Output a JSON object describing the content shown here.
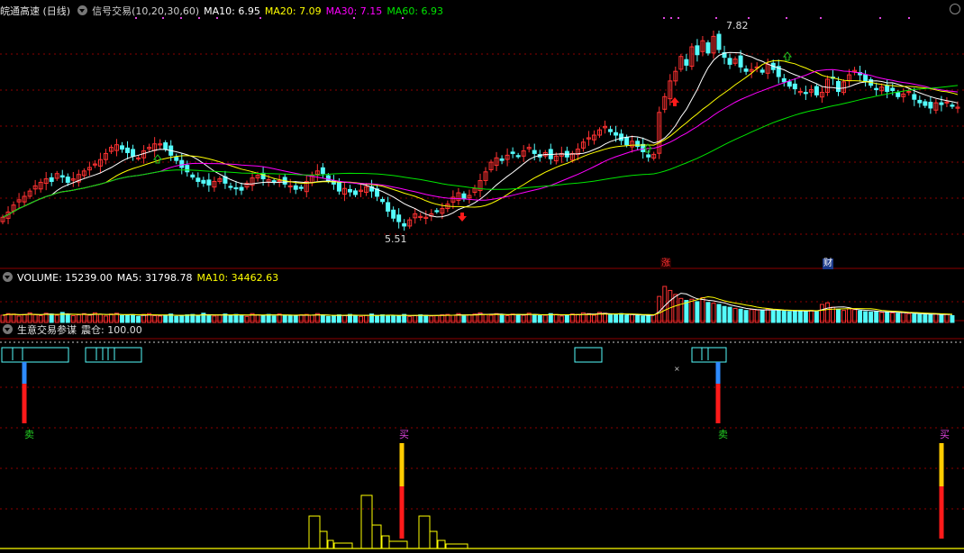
{
  "header1": {
    "title": "皖通高速 (日线)",
    "indicator": "信号交易(10,20,30,60)",
    "ma10": "MA10: 6.95",
    "ma20": "MA20: 7.09",
    "ma30": "MA30: 7.15",
    "ma60": "MA60: 6.93"
  },
  "header2": {
    "volume": "VOLUME: 15239.00",
    "ma5": "MA5: 31798.78",
    "ma10": "MA10: 34462.63"
  },
  "header3": {
    "title": "生意交易参谋",
    "position": "震仓: 100.00"
  },
  "annotations": {
    "high_label": "7.82",
    "low_label": "5.51",
    "zhang_tag": "涨",
    "cai_tag": "财",
    "sell1": "卖",
    "buy1": "买",
    "sell2": "卖",
    "buy2": "买"
  },
  "colors": {
    "up": "#ff3232",
    "down": "#54fcfc",
    "ma10": "#ffffff",
    "ma20": "#ffff00",
    "ma30": "#ff00ff",
    "ma60": "#00e600",
    "grid": "#8b0000",
    "sell": "#22cc22",
    "buy": "#dd44dd"
  },
  "chart_data": {
    "type": "candlestick",
    "price_range": [
      5.3,
      8.0
    ],
    "volume_range": [
      0,
      90000
    ],
    "high": 7.82,
    "low": 5.51,
    "series": [
      {
        "name": "MA10",
        "value": 6.95
      },
      {
        "name": "MA20",
        "value": 7.09
      },
      {
        "name": "MA30",
        "value": 7.15
      },
      {
        "name": "MA60",
        "value": 6.93
      }
    ],
    "close": [
      5.72,
      5.78,
      5.86,
      5.92,
      5.96,
      6.02,
      6.08,
      6.12,
      6.16,
      6.13,
      6.22,
      6.18,
      6.12,
      6.16,
      6.21,
      6.25,
      6.29,
      6.33,
      6.38,
      6.45,
      6.52,
      6.55,
      6.5,
      6.46,
      6.42,
      6.4,
      6.48,
      6.52,
      6.56,
      6.56,
      6.5,
      6.43,
      6.37,
      6.29,
      6.24,
      6.18,
      6.13,
      6.11,
      6.09,
      6.13,
      6.16,
      6.11,
      6.07,
      6.05,
      6.03,
      6.11,
      6.17,
      6.2,
      6.16,
      6.15,
      6.12,
      6.14,
      6.1,
      6.08,
      6.04,
      6.05,
      6.13,
      6.2,
      6.25,
      6.22,
      6.14,
      6.1,
      6.02,
      6.05,
      6.01,
      5.98,
      6.03,
      6.07,
      6.02,
      5.96,
      5.9,
      5.79,
      5.71,
      5.67,
      5.62,
      5.69,
      5.76,
      5.73,
      5.72,
      5.76,
      5.79,
      5.82,
      5.87,
      5.95,
      6.0,
      5.93,
      5.97,
      6.05,
      6.14,
      6.24,
      6.35,
      6.4,
      6.37,
      6.43,
      6.45,
      6.42,
      6.48,
      6.52,
      6.45,
      6.41,
      6.46,
      6.39,
      6.42,
      6.45,
      6.41,
      6.45,
      6.5,
      6.58,
      6.63,
      6.66,
      6.72,
      6.76,
      6.7,
      6.66,
      6.6,
      6.55,
      6.59,
      6.53,
      6.47,
      6.41,
      6.44,
      6.92,
      7.1,
      7.28,
      7.39,
      7.56,
      7.46,
      7.67,
      7.58,
      7.74,
      7.6,
      7.79,
      7.64,
      7.55,
      7.47,
      7.53,
      7.44,
      7.39,
      7.41,
      7.44,
      7.38,
      7.47,
      7.41,
      7.33,
      7.27,
      7.22,
      7.19,
      7.16,
      7.14,
      7.18,
      7.12,
      7.15,
      7.3,
      7.31,
      7.16,
      7.27,
      7.35,
      7.4,
      7.35,
      7.27,
      7.23,
      7.18,
      7.21,
      7.16,
      7.17,
      7.1,
      7.13,
      7.16,
      7.07,
      7.03,
      7.0,
      6.97,
      7.03,
      7.01,
      7.04,
      6.99,
      6.98
    ],
    "volume": [
      18000,
      22000,
      21000,
      16000,
      20000,
      24000,
      19000,
      17000,
      23000,
      21000,
      18000,
      25000,
      20000,
      17000,
      19000,
      22000,
      18000,
      24000,
      20000,
      16000,
      21000,
      23000,
      17000,
      19000,
      18000,
      15000,
      20000,
      22000,
      17000,
      16000,
      18000,
      21000,
      15000,
      17000,
      19000,
      20000,
      18000,
      23000,
      17000,
      16000,
      19000,
      21000,
      18000,
      20000,
      17000,
      15000,
      22000,
      19000,
      18000,
      20000,
      16000,
      21000,
      17000,
      18000,
      16000,
      19000,
      20000,
      18000,
      22000,
      17000,
      15000,
      16000,
      19000,
      18000,
      20000,
      17000,
      15000,
      18000,
      21000,
      16000,
      19000,
      17000,
      18000,
      16000,
      20000,
      15000,
      17000,
      19000,
      18000,
      16000,
      17000,
      19000,
      20000,
      18000,
      22000,
      16000,
      19000,
      21000,
      24000,
      20000,
      18000,
      22000,
      19000,
      17000,
      21000,
      20000,
      18000,
      23000,
      19000,
      17000,
      18000,
      22000,
      20000,
      16000,
      19000,
      21000,
      20000,
      24000,
      22000,
      18000,
      25000,
      23000,
      20000,
      19000,
      22000,
      18000,
      20000,
      17000,
      16000,
      18000,
      19000,
      65000,
      90000,
      80000,
      70000,
      60000,
      55000,
      58000,
      52000,
      62000,
      50000,
      48000,
      45000,
      40000,
      38000,
      35000,
      33000,
      30000,
      32000,
      31000,
      30000,
      34000,
      29000,
      31000,
      28000,
      27000,
      30000,
      29000,
      28000,
      30000,
      27000,
      45000,
      49000,
      38000,
      33000,
      30000,
      34000,
      32000,
      29000,
      27000,
      26000,
      28000,
      25000,
      26000,
      24000,
      23000,
      25000,
      22000,
      21000,
      20000,
      19000,
      22000,
      21000,
      18000,
      20000,
      17000
    ]
  }
}
